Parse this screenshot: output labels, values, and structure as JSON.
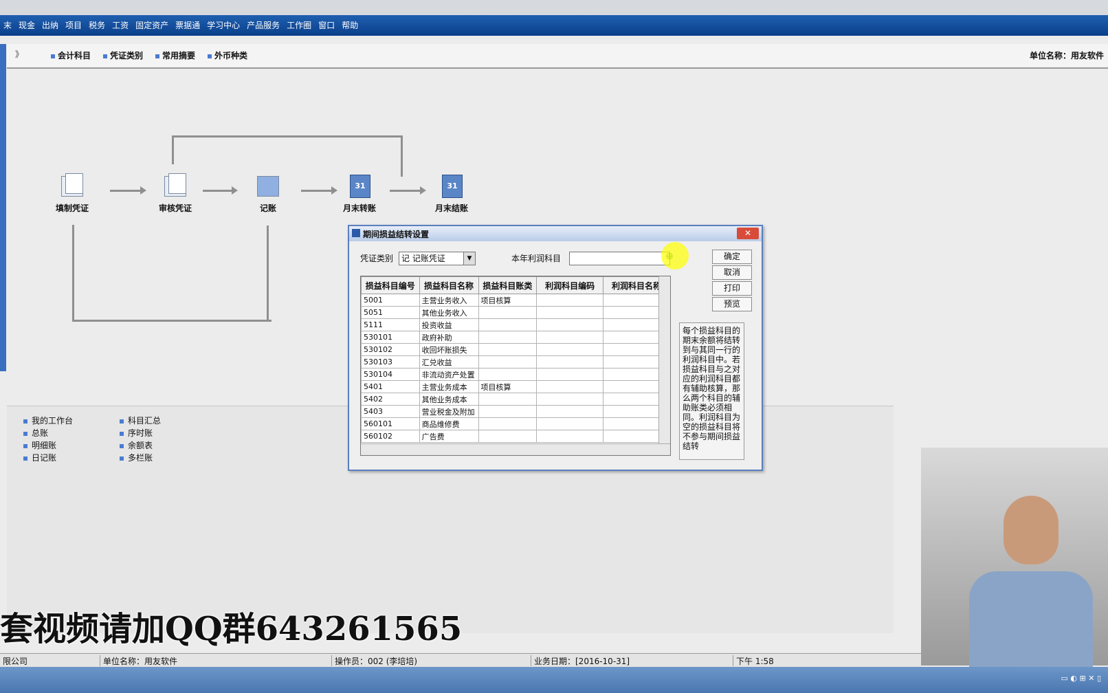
{
  "menu": [
    "末",
    "现金",
    "出纳",
    "项目",
    "税务",
    "工资",
    "固定资产",
    "票据通",
    "学习中心",
    "产品服务",
    "工作圈",
    "窗口",
    "帮助"
  ],
  "toolbar": {
    "collapse": "》",
    "items": [
      "会计科目",
      "凭证类别",
      "常用摘要",
      "外币种类"
    ],
    "unit": "单位名称：用友软件"
  },
  "flow": {
    "nodes": [
      {
        "label": "填制凭证",
        "icon": "voucher-edit-icon"
      },
      {
        "label": "审核凭证",
        "icon": "voucher-review-icon"
      },
      {
        "label": "记账",
        "icon": "ledger-post-icon"
      },
      {
        "label": "月末转账",
        "icon": "month-transfer-icon",
        "cal": "31"
      },
      {
        "label": "月末结账",
        "icon": "month-close-icon",
        "cal": "31"
      }
    ]
  },
  "links": {
    "col1": [
      "我的工作台",
      "总账",
      "明细账",
      "日记账"
    ],
    "col2": [
      "科目汇总",
      "序时账",
      "余额表",
      "多栏账"
    ]
  },
  "dialog": {
    "title": "期间损益结转设置",
    "voucher_type_label": "凭证类别",
    "voucher_type_value": "记   记账凭证",
    "profit_subject_label": "本年利润科目",
    "buttons": [
      "确定",
      "取消",
      "打印",
      "预览"
    ],
    "columns": [
      "损益科目编号",
      "损益科目名称",
      "损益科目账类",
      "利润科目编码",
      "利润科目名称"
    ],
    "rows": [
      [
        "5001",
        "主营业务收入",
        "项目核算",
        "",
        ""
      ],
      [
        "5051",
        "其他业务收入",
        "",
        "",
        ""
      ],
      [
        "5111",
        "投资收益",
        "",
        "",
        ""
      ],
      [
        "530101",
        "政府补助",
        "",
        "",
        ""
      ],
      [
        "530102",
        "收回坏账损失",
        "",
        "",
        ""
      ],
      [
        "530103",
        "汇兑收益",
        "",
        "",
        ""
      ],
      [
        "530104",
        "非流动资产处置",
        "",
        "",
        ""
      ],
      [
        "5401",
        "主营业务成本",
        "项目核算",
        "",
        ""
      ],
      [
        "5402",
        "其他业务成本",
        "",
        "",
        ""
      ],
      [
        "5403",
        "营业税金及附加",
        "",
        "",
        ""
      ],
      [
        "560101",
        "商品维修费",
        "",
        "",
        ""
      ],
      [
        "560102",
        "广告费",
        "",
        "",
        ""
      ]
    ],
    "note": "每个损益科目的期末余额将结转到与其同一行的利润科目中。若损益科目与之对应的利润科目都有辅助核算，那么两个科目的辅助账类必须相同。利润科目为空的损益科目将不参与期间损益结转"
  },
  "watermark": "套视频请加QQ群643261565",
  "status": {
    "company": "限公司",
    "unit": "单位名称：用友软件",
    "operator": "操作员：002 (李培培)",
    "date": "业务日期：[2016-10-31]",
    "time": "下午 1:58"
  },
  "colors": {
    "menubar": "#0a3f8a",
    "accent": "#4a7bd1",
    "close": "#d84b3a"
  }
}
